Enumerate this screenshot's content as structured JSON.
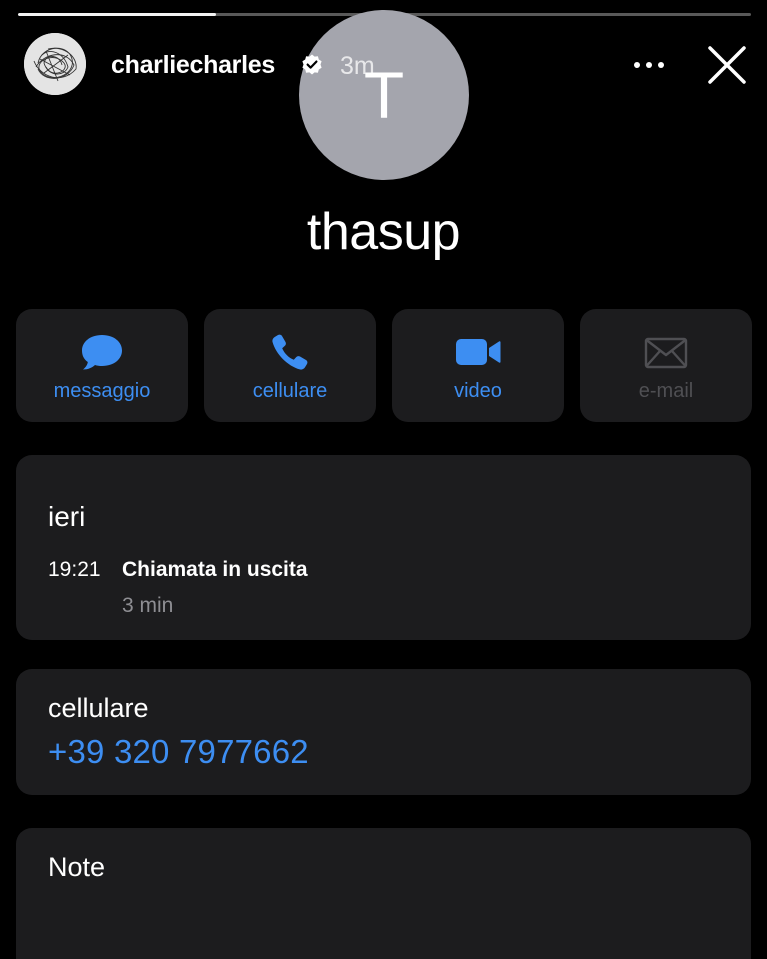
{
  "story": {
    "progress_fraction": 0.27,
    "username": "charliecharles",
    "time_ago": "3m",
    "icons": {
      "verified": "verified-badge-icon",
      "more": "more-options-icon",
      "close": "close-icon"
    }
  },
  "contact": {
    "initial": "T",
    "name": "thasup"
  },
  "actions": [
    {
      "label": "messaggio",
      "icon": "message-bubble-icon",
      "enabled": true
    },
    {
      "label": "cellulare",
      "icon": "phone-icon",
      "enabled": true
    },
    {
      "label": "video",
      "icon": "video-camera-icon",
      "enabled": true
    },
    {
      "label": "e-mail",
      "icon": "envelope-icon",
      "enabled": false
    }
  ],
  "call_history": {
    "day": "ieri",
    "time": "19:21",
    "type": "Chiamata in uscita",
    "duration": "3 min"
  },
  "phone": {
    "label": "cellulare",
    "number": "+39 320 7977662"
  },
  "notes": {
    "label": "Note"
  },
  "colors": {
    "background": "#000000",
    "card": "#1c1c1e",
    "accent": "#3d8ef2",
    "disabled": "#4f4f53",
    "avatar": "#a4a5ad"
  }
}
